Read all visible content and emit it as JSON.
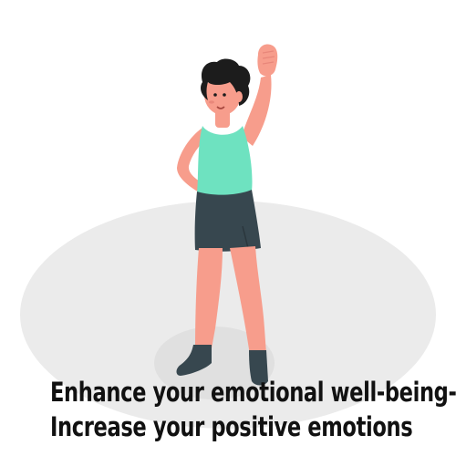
{
  "caption": {
    "line1": "Enhance your emotional well-being-",
    "line2": "Increase your positive emotions"
  },
  "colors": {
    "background": "#ffffff",
    "floor_ellipse": "#ebebeb",
    "floor_shadow": "#e0e0e0",
    "skin": "#f79d8c",
    "skin_shade": "#e8877a",
    "top": "#6ee2c0",
    "skirt": "#37474f",
    "hair": "#1c1c1c",
    "shoes": "#37474f",
    "text": "#111111"
  },
  "icons": {
    "figure": "woman-raising-fist-icon"
  }
}
